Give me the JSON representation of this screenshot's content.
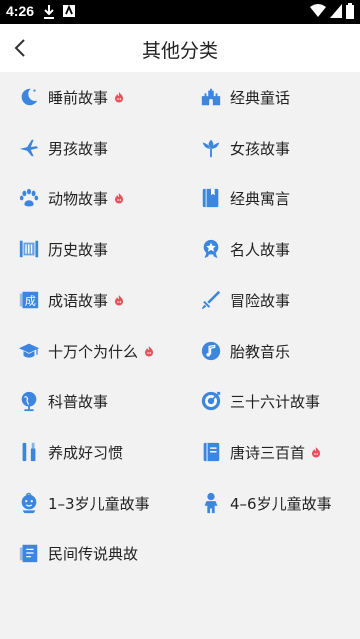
{
  "status": {
    "time": "4:26"
  },
  "header": {
    "title": "其他分类"
  },
  "colors": {
    "accent": "#3d86e0",
    "hot": "#e8505b"
  },
  "categories": [
    {
      "label": "睡前故事",
      "icon": "moon-icon",
      "hot": true
    },
    {
      "label": "经典童话",
      "icon": "castle-icon",
      "hot": false
    },
    {
      "label": "男孩故事",
      "icon": "airplane-icon",
      "hot": false
    },
    {
      "label": "女孩故事",
      "icon": "flower-icon",
      "hot": false
    },
    {
      "label": "动物故事",
      "icon": "paw-icon",
      "hot": true
    },
    {
      "label": "经典寓言",
      "icon": "book-icon",
      "hot": false
    },
    {
      "label": "历史故事",
      "icon": "scroll-icon",
      "hot": false
    },
    {
      "label": "名人故事",
      "icon": "medal-icon",
      "hot": false
    },
    {
      "label": "成语故事",
      "icon": "idiom-icon",
      "hot": true
    },
    {
      "label": "冒险故事",
      "icon": "sword-icon",
      "hot": false
    },
    {
      "label": "十万个为什么",
      "icon": "graduation-cap-icon",
      "hot": true
    },
    {
      "label": "胎教音乐",
      "icon": "music-note-icon",
      "hot": false
    },
    {
      "label": "科普故事",
      "icon": "globe-icon",
      "hot": false
    },
    {
      "label": "三十六计故事",
      "icon": "target-icon",
      "hot": false
    },
    {
      "label": "养成好习惯",
      "icon": "toothbrush-icon",
      "hot": false
    },
    {
      "label": "唐诗三百首",
      "icon": "notebook-icon",
      "hot": true
    },
    {
      "label": "1–3岁儿童故事",
      "icon": "baby-face-icon",
      "hot": false
    },
    {
      "label": "4–6岁儿童故事",
      "icon": "child-icon",
      "hot": false
    },
    {
      "label": "民间传说典故",
      "icon": "folk-book-icon",
      "hot": false
    }
  ]
}
